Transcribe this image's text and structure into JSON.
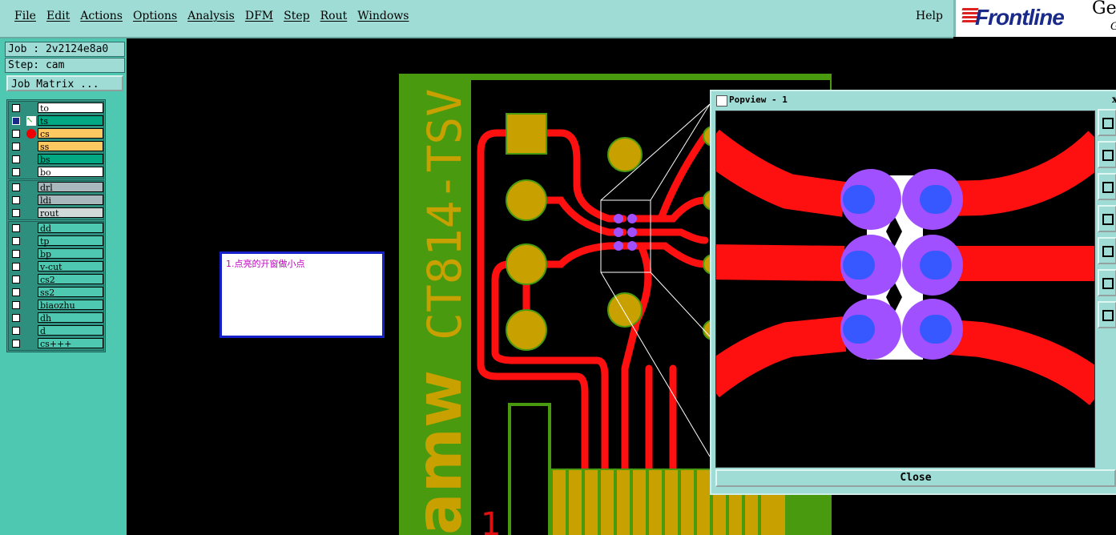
{
  "menu": {
    "items": [
      "File",
      "Edit",
      "Actions",
      "Options",
      "Analysis",
      "DFM",
      "Step",
      "Rout",
      "Windows"
    ],
    "help": "Help"
  },
  "logo": {
    "word": "Frontline",
    "brand": "Ger",
    "sub": "G"
  },
  "job": {
    "job": "Job : 2v2124e8a0",
    "step": "Step: cam",
    "matrix_button": "Job Matrix ..."
  },
  "layers": {
    "group1": [
      {
        "name": "to",
        "color": "#ffffff",
        "checked": false,
        "mark": ""
      },
      {
        "name": "ts",
        "color": "#00a884",
        "checked": true,
        "mark": "arrow"
      },
      {
        "name": "cs",
        "color": "#ffc860",
        "checked": false,
        "mark": "red-dot"
      },
      {
        "name": "ss",
        "color": "#ffc860",
        "checked": false,
        "mark": ""
      },
      {
        "name": "bs",
        "color": "#00a884",
        "checked": false,
        "mark": ""
      },
      {
        "name": "bo",
        "color": "#ffffff",
        "checked": false,
        "mark": ""
      }
    ],
    "group2": [
      {
        "name": "drl",
        "color": "#a8b8bc",
        "checked": false
      },
      {
        "name": "ldi",
        "color": "#a8b8bc",
        "checked": false
      },
      {
        "name": "rout",
        "color": "#d0d8d8",
        "checked": false
      }
    ],
    "group3": [
      {
        "name": "dd",
        "color": "#4ec8b0",
        "checked": false
      },
      {
        "name": "tp",
        "color": "#4ec8b0",
        "checked": false
      },
      {
        "name": "bp",
        "color": "#4ec8b0",
        "checked": false
      },
      {
        "name": "v-cut",
        "color": "#4ec8b0",
        "checked": false
      },
      {
        "name": "cs2",
        "color": "#4ec8b0",
        "checked": false
      },
      {
        "name": "ss2",
        "color": "#4ec8b0",
        "checked": false
      },
      {
        "name": "biaozhu",
        "color": "#4ec8b0",
        "checked": false
      },
      {
        "name": "dh",
        "color": "#4ec8b0",
        "checked": false
      },
      {
        "name": "d",
        "color": "#4ec8b0",
        "checked": false
      },
      {
        "name": "cs+++",
        "color": "#4ec8b0",
        "checked": false
      }
    ]
  },
  "note": {
    "text": "1.点亮的开窗做小点"
  },
  "board": {
    "text": "CT814-TSV",
    "text2": "amw",
    "digit": "1"
  },
  "popview": {
    "title": "Popview - 1",
    "close_label": "Close"
  },
  "colors": {
    "board": "#4a9a10",
    "gold": "#c8a000",
    "trace": "#ff1010",
    "pad": "#a050ff",
    "padcore": "#3858ff"
  }
}
